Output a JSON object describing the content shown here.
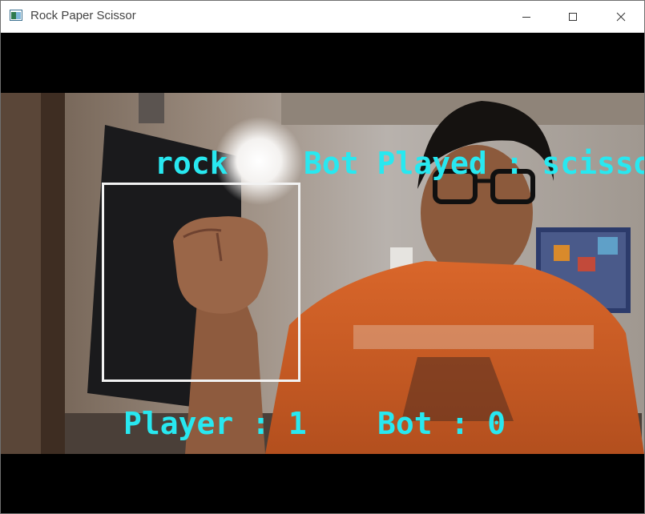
{
  "window": {
    "title": "Rock Paper Scissor",
    "icon": "image-window-icon"
  },
  "controls": {
    "minimize_icon": "minimize-icon",
    "maximize_icon": "maximize-icon",
    "close_icon": "close-icon"
  },
  "overlay": {
    "gesture": "rock",
    "bot_played": "Bot Played : scissor",
    "player_score": "Player : 1",
    "bot_score": "Bot : 0"
  },
  "colors": {
    "overlay_text": "#28e8f0",
    "roi_box": "#f2f2f2",
    "letterbox": "#000000",
    "shirt": "#d9662a"
  }
}
